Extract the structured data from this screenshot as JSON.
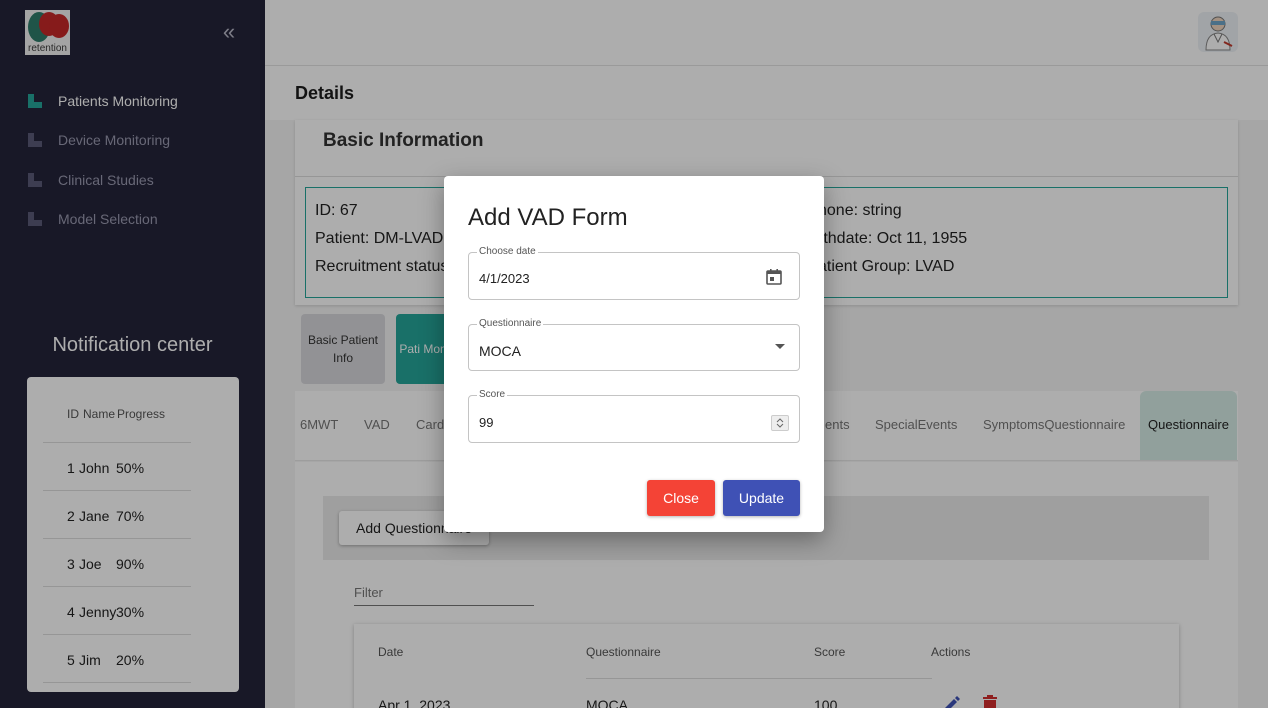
{
  "app": {
    "logo_text": "retention"
  },
  "sidebar": {
    "items": [
      {
        "label": "Patients Monitoring",
        "active": true
      },
      {
        "label": "Device Monitoring",
        "active": false
      },
      {
        "label": "Clinical Studies",
        "active": false
      },
      {
        "label": "Model Selection",
        "active": false
      }
    ],
    "collapse_icon": "double-chevron-left-icon"
  },
  "notifications": {
    "title": "Notification center",
    "header": {
      "id": "ID",
      "name": "Name",
      "progress": "Progress"
    },
    "rows": [
      {
        "id": "1",
        "name": "John",
        "progress": "50%"
      },
      {
        "id": "2",
        "name": "Jane",
        "progress": "70%"
      },
      {
        "id": "3",
        "name": "Joe",
        "progress": "90%"
      },
      {
        "id": "4",
        "name": "Jenny",
        "progress": "30%"
      },
      {
        "id": "5",
        "name": "Jim",
        "progress": "20%"
      }
    ]
  },
  "header": {
    "page_title": "Details"
  },
  "basic_info": {
    "title": "Basic Information",
    "id_text": "ID: 67",
    "patient_text": "Patient: DM-LVAD-",
    "recruitment_text": "Recruitment status",
    "phone_text": "none: string",
    "birthdate_text": "rthdate: Oct 11, 1955",
    "group_text": "atient Group: LVAD"
  },
  "side_tabs": {
    "basic": "Basic Patient Info",
    "monitoring": "Pati Monit"
  },
  "tabs": [
    "6MWT",
    "VAD",
    "Card",
    "ents",
    "SpecialEvents",
    "SymptomsQuestionnaire",
    "Questionnaire"
  ],
  "active_tab": "Questionnaire",
  "questionnaire_panel": {
    "add_button": "Add Questionnaire",
    "filter_placeholder": "Filter",
    "columns": [
      "Date",
      "Questionnaire",
      "Score",
      "Actions"
    ],
    "rows": [
      {
        "date": "Apr 1, 2023",
        "questionnaire": "MOCA",
        "score": "100"
      }
    ]
  },
  "dialog": {
    "title": "Add VAD Form",
    "date_label": "Choose date",
    "date_value": "4/1/2023",
    "questionnaire_label": "Questionnaire",
    "questionnaire_value": "MOCA",
    "score_label": "Score",
    "score_value": "99",
    "close_label": "Close",
    "update_label": "Update"
  },
  "colors": {
    "sidebar_bg": "#24243a",
    "accent_teal": "#26a69a",
    "close_red": "#f44336",
    "update_indigo": "#3f51b5"
  }
}
